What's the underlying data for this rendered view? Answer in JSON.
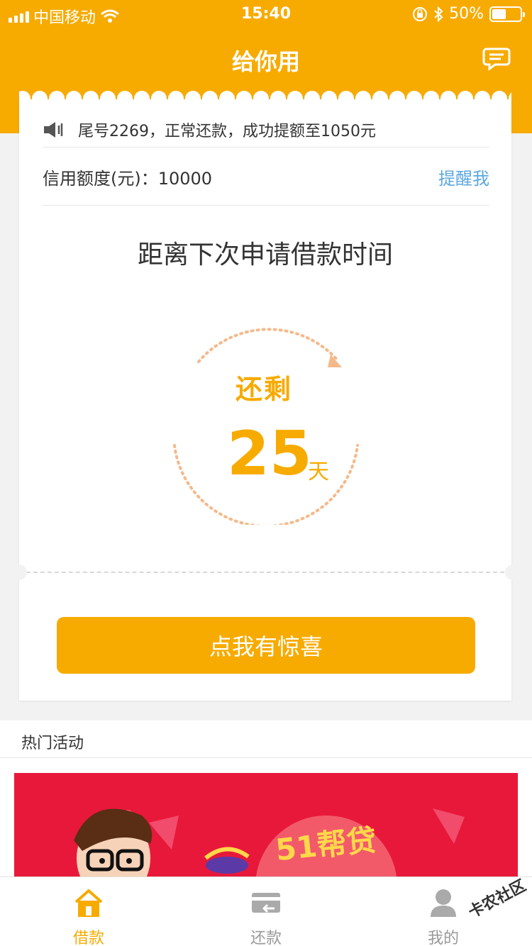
{
  "status_bar": {
    "carrier": "中国移动",
    "time": "15:40",
    "battery": "50%",
    "battery_level": 0.5
  },
  "header": {
    "title": "给你用"
  },
  "card": {
    "notice": "尾号2269，正常还款，成功提额至1050元",
    "credit_label": "信用额度(元)：10000",
    "remind_link": "提醒我",
    "heading": "距离下次申请借款时间",
    "remain_label": "还剩",
    "days_value": "25",
    "days_unit": "天",
    "surprise_button": "点我有惊喜"
  },
  "activities": {
    "title": "热门活动",
    "banner_text": "51帮贷"
  },
  "tabbar": {
    "tabs": [
      {
        "label": "借款",
        "icon": "home-icon",
        "active": true
      },
      {
        "label": "还款",
        "icon": "card-return-icon",
        "active": false
      },
      {
        "label": "我的",
        "icon": "user-icon",
        "active": false
      }
    ]
  },
  "watermark": "卡农社区",
  "colors": {
    "accent": "#f7ab00",
    "link": "#5aa7e0",
    "banner": "#e8183b"
  }
}
